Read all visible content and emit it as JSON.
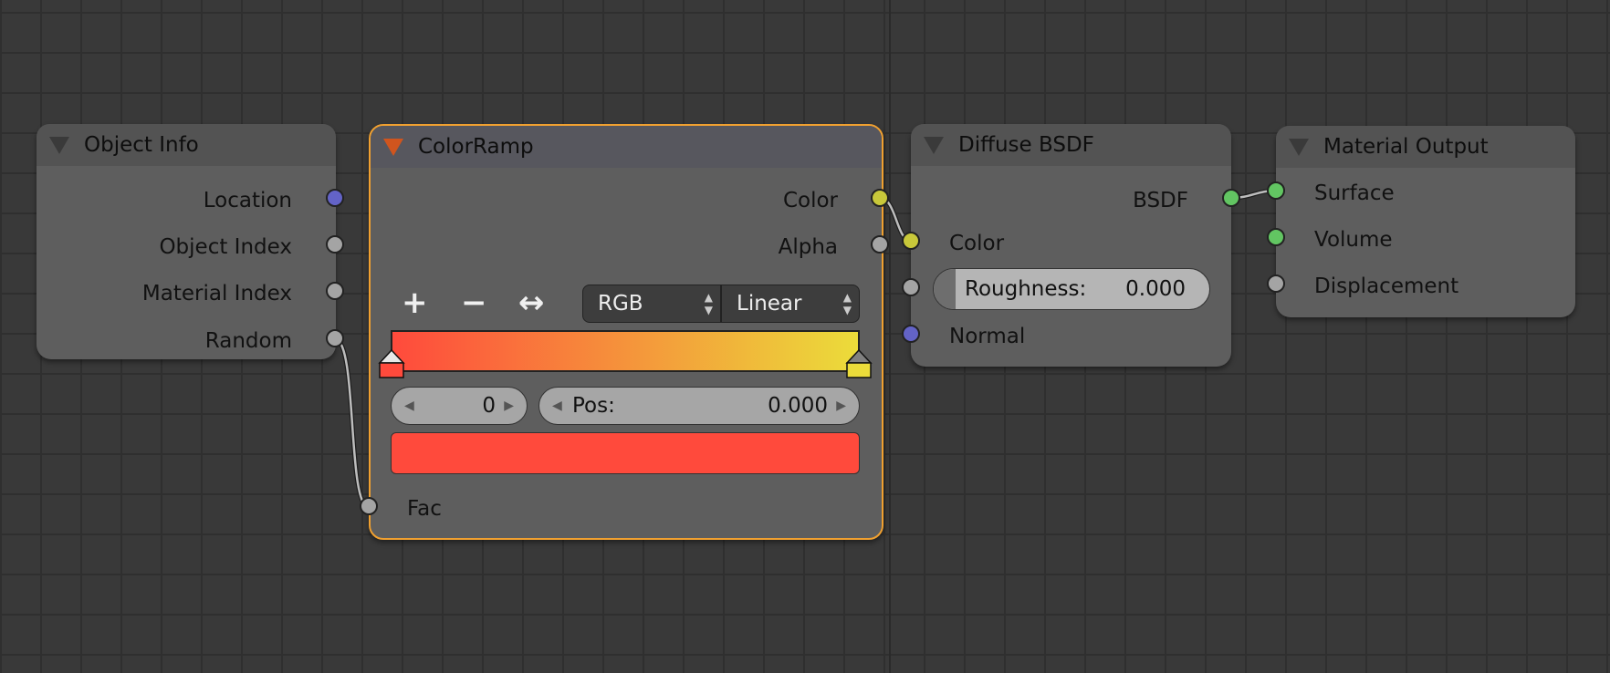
{
  "nodes": {
    "object_info": {
      "title": "Object Info",
      "outputs": [
        "Location",
        "Object Index",
        "Material Index",
        "Random"
      ]
    },
    "color_ramp": {
      "title": "ColorRamp",
      "outputs": [
        "Color",
        "Alpha"
      ],
      "tools": {
        "add": "+",
        "remove": "−",
        "flip": "↔"
      },
      "color_mode": "RGB",
      "interpolation": "Linear",
      "active_stop_index": "0",
      "pos_label": "Pos:",
      "pos_value": "0.000",
      "ramp_colors": {
        "start": "#ff4a3c",
        "end": "#ebdc3a"
      },
      "active_color": "#ff4a3c",
      "input": "Fac"
    },
    "diffuse_bsdf": {
      "title": "Diffuse BSDF",
      "output": "BSDF",
      "inputs": [
        "Color",
        "Normal"
      ],
      "roughness_label": "Roughness:",
      "roughness_value": "0.000"
    },
    "material_output": {
      "title": "Material Output",
      "inputs": [
        "Surface",
        "Volume",
        "Displacement"
      ]
    }
  },
  "colors": {
    "active_node_border": "#f0a030",
    "socket_vector": "#6363c7",
    "socket_float": "#a4a4a4",
    "socket_color": "#c8c83a",
    "socket_shader": "#62c562"
  }
}
